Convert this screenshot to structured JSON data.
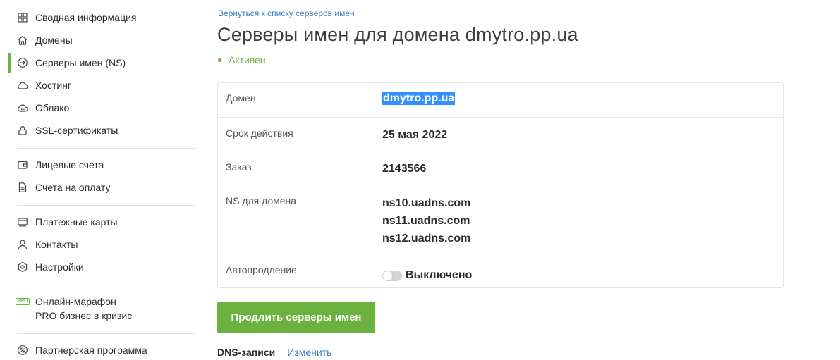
{
  "sidebar": {
    "group1": [
      {
        "label": "Сводная информация",
        "icon": "dashboard-icon"
      },
      {
        "label": "Домены",
        "icon": "home-icon"
      },
      {
        "label": "Серверы имен (NS)",
        "icon": "arrow-circle-icon",
        "active": true
      },
      {
        "label": "Хостинг",
        "icon": "cloud-icon"
      },
      {
        "label": "Облако",
        "icon": "cloud-server-icon"
      },
      {
        "label": "SSL-сертификаты",
        "icon": "lock-icon"
      }
    ],
    "group2": [
      {
        "label": "Лицевые счета",
        "icon": "wallet-icon"
      },
      {
        "label": "Счета на оплату",
        "icon": "document-icon"
      }
    ],
    "group3": [
      {
        "label": "Платежные карты",
        "icon": "card-icon"
      },
      {
        "label": "Контакты",
        "icon": "user-icon"
      },
      {
        "label": "Настройки",
        "icon": "gear-icon"
      }
    ],
    "promo": {
      "badge": "PRO",
      "line1": "Онлайн-марафон",
      "line2": "PRO бизнес в кризис"
    },
    "partner": {
      "label": "Партнерская программа",
      "icon": "percent-icon"
    },
    "accent_color": "#6ab23d"
  },
  "main": {
    "back_link": "Вернуться к списку серверов имен",
    "title": "Серверы имен для домена dmytro.pp.ua",
    "status": "Активен",
    "table": {
      "domain_label": "Домен",
      "domain_value": "dmytro.pp.ua",
      "expiry_label": "Срок действия",
      "expiry_value": "25 мая 2022",
      "order_label": "Заказ",
      "order_value": "2143566",
      "ns_label": "NS для домена",
      "ns_values": [
        "ns10.uadns.com",
        "ns11.uadns.com",
        "ns12.uadns.com"
      ],
      "autorenew_label": "Автопродление",
      "autorenew_value": "Выключено",
      "autorenew_enabled": false
    },
    "renew_button": "Продлить серверы имен",
    "dns_label": "DNS-записи",
    "dns_edit": "Изменить"
  }
}
